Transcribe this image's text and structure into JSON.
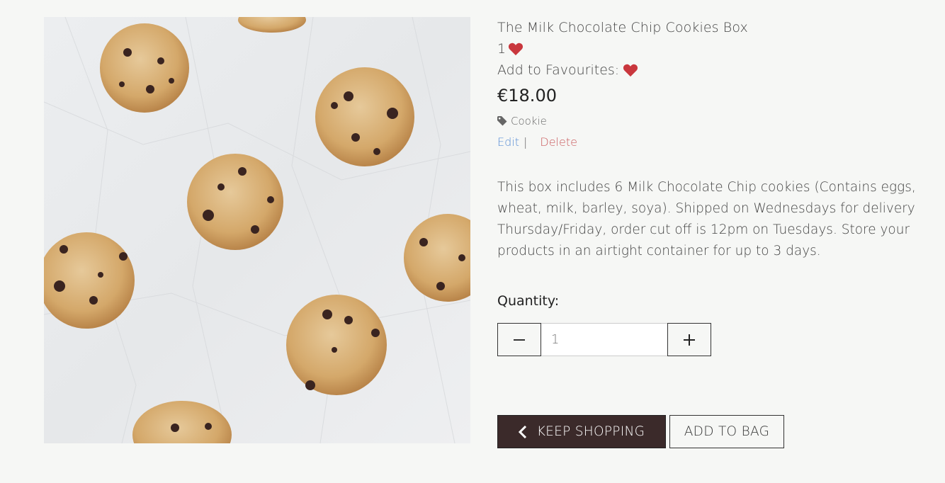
{
  "product": {
    "image_alt": "milk chocolate chip cookies on crumpled white paper",
    "title": "The Milk Chocolate Chip Cookies Box",
    "favourites_count": "1",
    "add_to_favourites_label": "Add to Favourites:",
    "price": "€18.00",
    "category": "Cookie",
    "description": "This box includes 6 Milk Chocolate Chip cookies (Contains eggs, wheat, milk, barley, soya). Shipped on Wednesdays for delivery Thursday/Friday, order cut off is 12pm on Tuesdays. Store your products in an airtight container for up to 3 days."
  },
  "admin": {
    "edit_label": "Edit",
    "separator": "|",
    "delete_label": "Delete"
  },
  "quantity": {
    "label": "Quantity:",
    "value": "1"
  },
  "actions": {
    "keep_shopping_label": "KEEP SHOPPING",
    "add_to_bag_label": "ADD TO BAG"
  },
  "icons": {
    "heart": "heart-icon",
    "tag": "tag-icon",
    "minus": "minus-icon",
    "plus": "plus-icon",
    "chevron": "chevron-left-icon"
  },
  "colors": {
    "heart": "#c9373d",
    "edit_link": "#5b8fd6",
    "delete_link": "#c9585b",
    "keep_shopping_bg": "#3b2a2a",
    "page_bg": "#f6f7f5"
  }
}
